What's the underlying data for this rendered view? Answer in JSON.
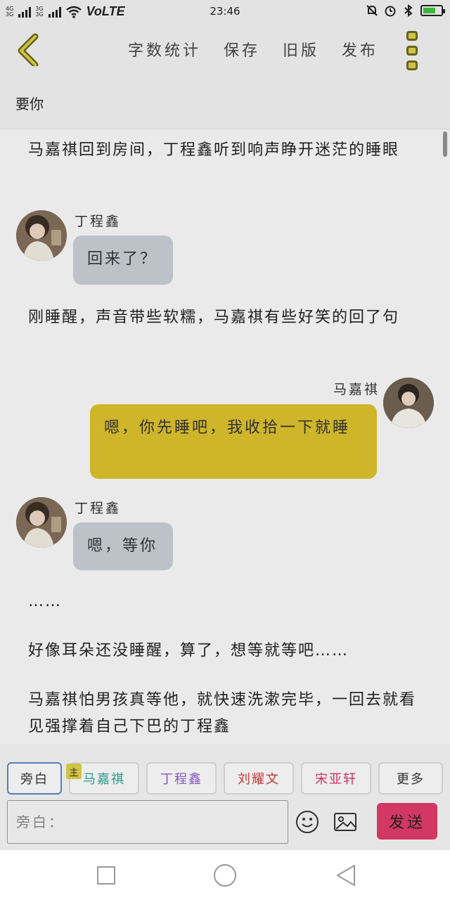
{
  "status_bar": {
    "network_top": "4G",
    "network_bottom": "3G",
    "volte": "VoLTE",
    "time": "23:46"
  },
  "toolbar": {
    "word_count": "字数统计",
    "save": "保存",
    "old_version": "旧版",
    "publish": "发布"
  },
  "title": "要你",
  "content": {
    "narration_1": "马嘉祺回到房间，丁程鑫听到响声睁开迷茫的睡眼",
    "msg_1_speaker": "丁程鑫",
    "msg_1_text": "回来了？",
    "narration_2": "刚睡醒，声音带些软糯，马嘉祺有些好笑的回了句",
    "msg_2_speaker": "马嘉祺",
    "msg_2_text": "嗯，你先睡吧，我收拾一下就睡",
    "msg_3_speaker": "丁程鑫",
    "msg_3_text": "嗯，等你",
    "narration_3": "……",
    "narration_4": "好像耳朵还没睡醒，算了，想等就等吧……",
    "narration_5": "马嘉祺怕男孩真等他，就快速洗漱完毕，一回去就看见强撑着自己下巴的丁程鑫"
  },
  "roles": {
    "narrator": "旁白",
    "host_badge": "主",
    "ma_jiaqi": "马嘉祺",
    "ding_chengxin": "丁程鑫",
    "liu_yaowen": "刘耀文",
    "song_yaxuan": "宋亚轩",
    "more": "更多"
  },
  "input": {
    "placeholder": "旁白：",
    "send": "发送"
  },
  "colors": {
    "accent_yellow": "#d7bd2b",
    "send_pink": "#dc3a68",
    "left_bubble": "#c5cad2",
    "chip_ma": "#2aa18c",
    "chip_ding": "#8a5bc9",
    "chip_liu": "#d13a3a",
    "chip_song": "#d6336c"
  }
}
